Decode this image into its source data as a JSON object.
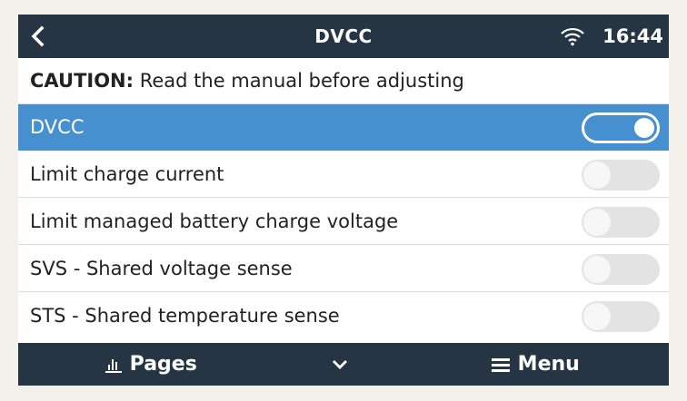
{
  "header": {
    "title": "DVCC",
    "time": "16:44",
    "back_icon": "chevron-left-icon",
    "status_icon": "wifi-icon"
  },
  "caution": {
    "strong": "CAUTION:",
    "text": " Read the manual before adjusting"
  },
  "settings": [
    {
      "label": "DVCC",
      "enabled": true,
      "selected": true
    },
    {
      "label": "Limit charge current",
      "enabled": false,
      "selected": false
    },
    {
      "label": "Limit managed battery charge voltage",
      "enabled": false,
      "selected": false
    },
    {
      "label": "SVS - Shared voltage sense",
      "enabled": false,
      "selected": false
    },
    {
      "label": "STS - Shared temperature sense",
      "enabled": false,
      "selected": false
    }
  ],
  "footer": {
    "pages_label": "Pages",
    "menu_label": "Menu",
    "pages_icon": "bar-chart-icon",
    "down_icon": "chevron-down-icon",
    "menu_icon": "hamburger-icon"
  },
  "colors": {
    "bar": "#253544",
    "selected": "#4790d0",
    "toggle_off": "#e3e3e3",
    "background": "#f4f1ed"
  }
}
